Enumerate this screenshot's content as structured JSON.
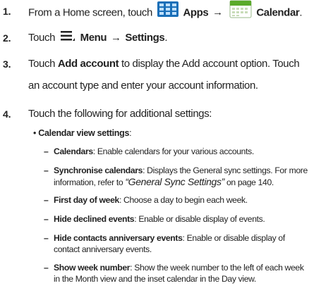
{
  "steps": [
    {
      "num": "1.",
      "pre": "From a Home screen, touch",
      "apps": "Apps",
      "arrow": "→",
      "calendar": "Calendar",
      "end": "."
    },
    {
      "num": "2.",
      "pre": "Touch",
      "menu": "Menu",
      "arrow": "→",
      "settings": "Settings",
      "end": "."
    },
    {
      "num": "3.",
      "pre": "Touch",
      "bold": "Add account",
      "post": "to display the Add account option. Touch",
      "line2": "an account type and enter your account information."
    },
    {
      "num": "4.",
      "text": "Touch the following for additional settings:"
    }
  ],
  "bullet": {
    "symbol": "•",
    "label": "Calendar view settings",
    "colon": ":"
  },
  "subitems": [
    {
      "dash": "–",
      "term": "Calendars",
      "desc": ": Enable calendars for your various accounts."
    },
    {
      "dash": "–",
      "term": "Synchronise calendars",
      "desc": ": Displays the General sync settings. For more",
      "line2_pre": "information, refer to ",
      "line2_link": "“General Sync Settings”",
      "line2_post": " on page 140."
    },
    {
      "dash": "–",
      "term": "First day of week",
      "desc": ": Choose a day to begin each week."
    },
    {
      "dash": "–",
      "term": "Hide declined events",
      "desc": ": Enable or disable display of events."
    },
    {
      "dash": "–",
      "term": "Hide contacts anniversary events",
      "desc": ": Enable or disable display of",
      "line2": "contact anniversary events."
    },
    {
      "dash": "–",
      "term": "Show week number",
      "desc": ": Show the week number to the left of each week",
      "line2": "in the Month view and the inset calendar in the Day view."
    }
  ],
  "colors": {
    "text": "#222222",
    "apps_icon": "#1a6fb8",
    "calendar_icon": "#5aaa2a"
  },
  "icons": {
    "apps": "apps-grid-icon",
    "calendar": "calendar-icon",
    "menu": "menu-icon"
  }
}
